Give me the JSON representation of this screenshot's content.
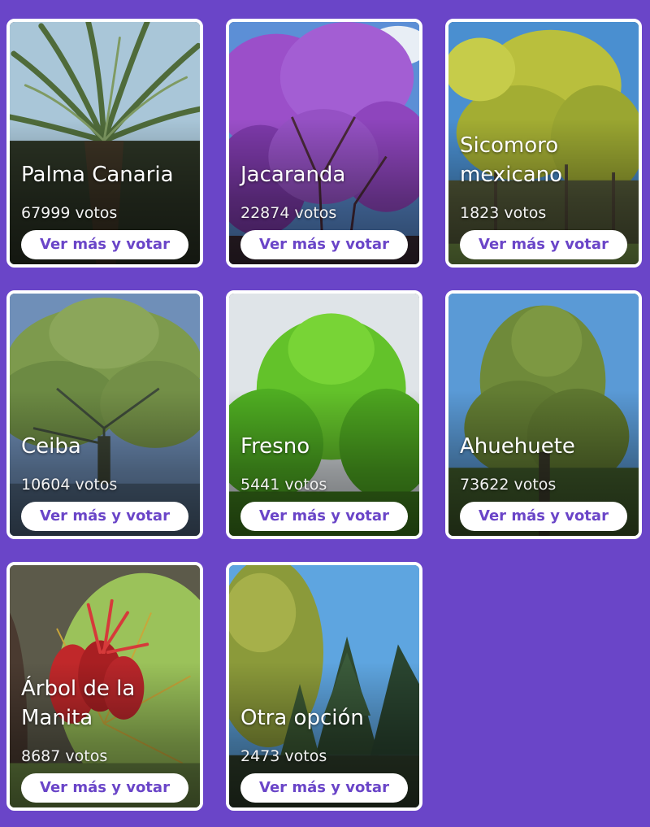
{
  "cards": [
    {
      "name": "Palma Canaria",
      "votes": "67999 votos",
      "button": "Ver más y votar"
    },
    {
      "name": "Jacaranda",
      "votes": "22874 votos",
      "button": "Ver más y votar"
    },
    {
      "name": "Sicomoro\nmexicano",
      "votes": "1823 votos",
      "button": "Ver más y votar"
    },
    {
      "name": "Ceiba",
      "votes": "10604 votos",
      "button": "Ver más y votar"
    },
    {
      "name": "Fresno",
      "votes": "5441 votos",
      "button": "Ver más y votar"
    },
    {
      "name": "Ahuehuete",
      "votes": "73622 votos",
      "button": "Ver más y votar"
    },
    {
      "name": "Árbol de la\nManita",
      "votes": "8687 votos",
      "button": "Ver más y votar"
    },
    {
      "name": "Otra opción",
      "votes": "2473 votos",
      "button": "Ver más y votar"
    }
  ],
  "colors": {
    "background": "#6a45c8",
    "accent": "#6a45c8",
    "card_border": "#ffffff"
  }
}
